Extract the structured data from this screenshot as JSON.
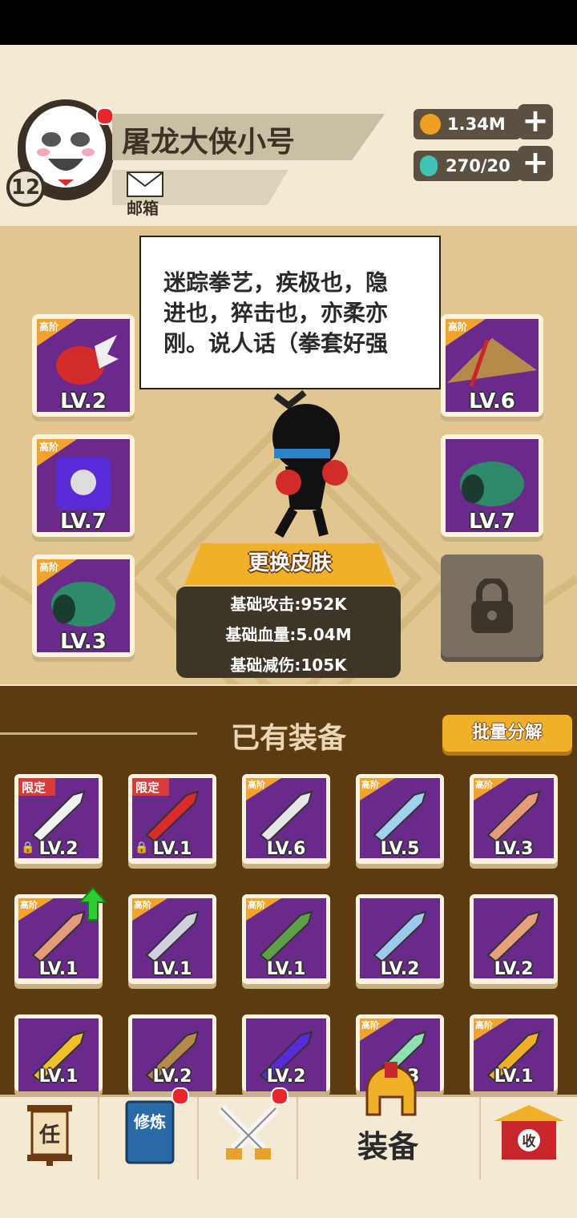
{
  "player": {
    "name": "屠龙大侠小号",
    "level": "12",
    "mail_label": "邮箱"
  },
  "currency": {
    "gold": "1.34M",
    "gems": "270/20"
  },
  "hero": {
    "description": [
      "迷踪拳艺，疾极也，隐",
      "进也，猝击也，亦柔亦",
      "刚。说人话（拳套好强"
    ],
    "change_skin_label": "更换皮肤",
    "stats": {
      "attack": "基础攻击:952K",
      "hp": "基础血量:5.04M",
      "reduction": "基础减伤:105K"
    }
  },
  "equipped_left": [
    {
      "tag": "高阶",
      "level": "LV.2",
      "icon": "red-gauntlet-icon"
    },
    {
      "tag": "高阶",
      "level": "LV.7",
      "icon": "purple-armor-icon"
    },
    {
      "tag": "高阶",
      "level": "LV.3",
      "icon": "green-bracer-icon"
    }
  ],
  "equipped_right": [
    {
      "tag": "高阶",
      "level": "LV.6",
      "icon": "straw-hat-icon"
    },
    {
      "tag": "",
      "level": "LV.7",
      "icon": "green-bracer-icon"
    }
  ],
  "owned_section": {
    "title": "已有装备",
    "batch_label": "批量分解"
  },
  "owned_items": [
    {
      "tag": "限定",
      "level": "LV.2",
      "locked": true,
      "icon": "toilet-paper-icon"
    },
    {
      "tag": "限定",
      "level": "LV.1",
      "locked": true,
      "icon": "chinese-knot-icon"
    },
    {
      "tag": "高阶",
      "level": "LV.6",
      "icon": "scimitar-icon"
    },
    {
      "tag": "高阶",
      "level": "LV.5",
      "icon": "blue-scimitar-icon"
    },
    {
      "tag": "高阶",
      "level": "LV.3",
      "icon": "wooden-sword-icon"
    },
    {
      "tag": "高阶",
      "level": "LV.1",
      "icon": "wooden-sword-icon",
      "upgrade": true
    },
    {
      "tag": "高阶",
      "level": "LV.1",
      "icon": "silver-ring-icon"
    },
    {
      "tag": "高阶",
      "level": "LV.1",
      "icon": "jade-ring-icon"
    },
    {
      "tag": "",
      "level": "LV.2",
      "icon": "blue-sword-icon"
    },
    {
      "tag": "",
      "level": "LV.2",
      "icon": "broad-sword-icon"
    },
    {
      "tag": "",
      "level": "LV.1",
      "icon": "gold-gauntlet-icon"
    },
    {
      "tag": "",
      "level": "LV.2",
      "icon": "straw-hat-icon"
    },
    {
      "tag": "",
      "level": "LV.2",
      "icon": "purple-armor-icon"
    },
    {
      "tag": "高阶",
      "level": "LV.3",
      "icon": "jade-sword-icon"
    },
    {
      "tag": "高阶",
      "level": "LV.1",
      "icon": "golden-helmet-icon"
    }
  ],
  "nav": {
    "tasks_glyph": "任",
    "cultivate_glyph": "修炼",
    "equipment_label": "装备",
    "collect_glyph": "收"
  }
}
